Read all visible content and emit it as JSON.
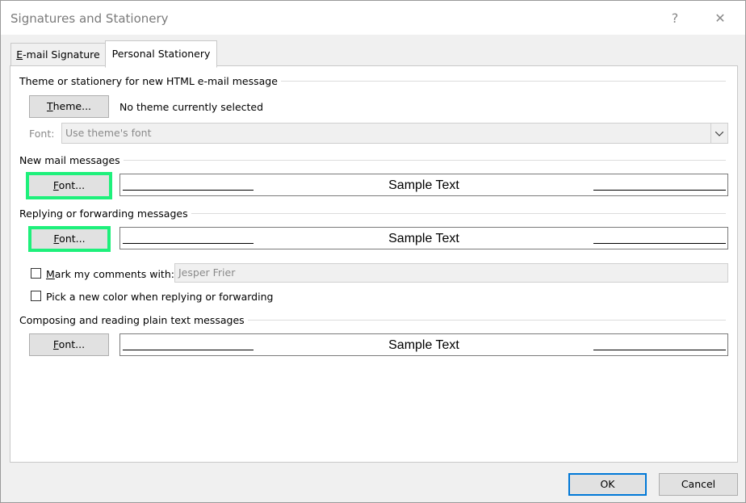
{
  "window": {
    "title": "Signatures and Stationery",
    "help_glyph": "?",
    "close_glyph": "✕"
  },
  "tabs": [
    {
      "label_prefix": "",
      "label_accel": "E",
      "label_rest": "-mail Signature"
    },
    {
      "label": "Personal Stationery"
    }
  ],
  "theme_section": {
    "label": "Theme or stationery for new HTML e-mail message",
    "theme_button_accel": "T",
    "theme_button_rest": "heme...",
    "theme_status": "No theme currently selected",
    "font_label": "Font:",
    "font_value": "Use theme's font"
  },
  "new_mail": {
    "label": "New mail messages",
    "font_button_accel": "F",
    "font_button_rest": "ont...",
    "sample_text": "Sample Text"
  },
  "reply": {
    "label": "Replying or forwarding messages",
    "font_button_accel": "F",
    "font_button_rest": "ont...",
    "sample_text": "Sample Text",
    "mark_comments_accel": "M",
    "mark_comments_rest": "ark my comments with:",
    "mark_comments_value": "Jesper Frier",
    "pick_color_label": "Pick a new color when replying or forwarding"
  },
  "plain": {
    "label": "Composing and reading plain text messages",
    "font_button_accel": "F",
    "font_button_rest": "ont...",
    "sample_text": "Sample Text"
  },
  "footer": {
    "ok_label": "OK",
    "cancel_label": "Cancel"
  },
  "colors": {
    "highlight": "#1ef07b",
    "focus": "#0078d7"
  }
}
